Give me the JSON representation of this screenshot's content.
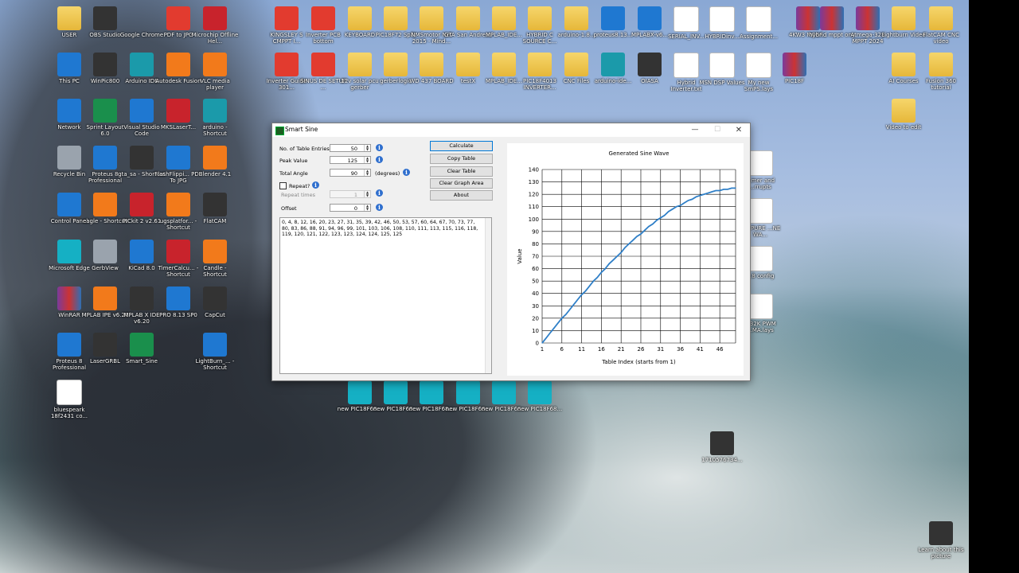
{
  "desktop": {
    "icons": [
      {
        "label": "USER",
        "color": "folder"
      },
      {
        "label": "OBS Studio",
        "color": "dark"
      },
      {
        "label": "Google Chrome",
        "color": "round"
      },
      {
        "label": "PDF to JPG",
        "color": "pdf"
      },
      {
        "label": "Microchip Offline Hel...",
        "color": "red"
      },
      {
        "label": "This PC",
        "color": "blue"
      },
      {
        "label": "WinPic800",
        "color": "dark"
      },
      {
        "label": "Arduino IDE",
        "color": "teal"
      },
      {
        "label": "Autodesk Fusion",
        "color": "orange"
      },
      {
        "label": "VLC media player",
        "color": "orange"
      },
      {
        "label": "Network",
        "color": "blue"
      },
      {
        "label": "Sprint Layout 6.0",
        "color": "green"
      },
      {
        "label": "Visual Studio Code",
        "color": "blue"
      },
      {
        "label": "MKSLaserT...",
        "color": "red"
      },
      {
        "label": "arduino - Shortcut",
        "color": "teal"
      },
      {
        "label": "Recycle Bin",
        "color": "gray"
      },
      {
        "label": "Proteus 8 Professional",
        "color": "blue"
      },
      {
        "label": "gta_sa - Shortcut",
        "color": "dark"
      },
      {
        "label": "FlashFlippi... PDF To JPG",
        "color": "blue"
      },
      {
        "label": "Blender 4.1",
        "color": "orange"
      },
      {
        "label": "Control Panel",
        "color": "blue"
      },
      {
        "label": "eagle - Shortcut",
        "color": "orange"
      },
      {
        "label": "PICkit 2 v2.61",
        "color": "red"
      },
      {
        "label": "ugsplatfor... - Shortcut",
        "color": "orange"
      },
      {
        "label": "FlatCAM",
        "color": "dark"
      },
      {
        "label": "Microsoft Edge",
        "color": "cyan"
      },
      {
        "label": "GerbView",
        "color": "gray"
      },
      {
        "label": "KiCad 8.0",
        "color": "blue"
      },
      {
        "label": "TimerCalcu... - Shortcut",
        "color": "red"
      },
      {
        "label": "Candle - Shortcut",
        "color": "orange"
      },
      {
        "label": "WinRAR",
        "color": "rar"
      },
      {
        "label": "MPLAB IPE v6.20",
        "color": "orange"
      },
      {
        "label": "MPLAB X IDE v6.20",
        "color": "dark"
      },
      {
        "label": "PRO 8.13 SP0",
        "color": "blue"
      },
      {
        "label": "CapCut",
        "color": "dark"
      },
      {
        "label": "Proteus 8 Professional",
        "color": "blue"
      },
      {
        "label": "LaserGRBL",
        "color": "dark"
      },
      {
        "label": "Smart_Sine",
        "color": "green"
      },
      {
        "label": "LightBurn_... - Shortcut",
        "color": "blue"
      },
      {
        "label": "bluespeark 18f2431 co...",
        "color": "doc"
      },
      {
        "label": "KINGSLEY S CMPPT I...",
        "color": "pdf"
      },
      {
        "label": "Inverter PCB bottom",
        "color": "pdf"
      },
      {
        "label": "KEYBOARD",
        "color": "folder"
      },
      {
        "label": "PIC18F72 Split",
        "color": "folder"
      },
      {
        "label": "NMSmotor Net 2015 - Mind...",
        "color": "folder"
      },
      {
        "label": "GTA San Andreas",
        "color": "folder"
      },
      {
        "label": "MPLAB_IDE...",
        "color": "folder"
      },
      {
        "label": "HYBRID C SOURCE C...",
        "color": "folder"
      },
      {
        "label": "arduino-1.8...",
        "color": "folder"
      },
      {
        "label": "proteus8.13...",
        "color": "blue"
      },
      {
        "label": "MPLABX-v6...",
        "color": "blue"
      },
      {
        "label": "SERIAL_INV...",
        "color": "doc"
      },
      {
        "label": "HYBRIDinv...",
        "color": "doc"
      },
      {
        "label": "Assignment...",
        "color": "doc"
      },
      {
        "label": "4KW3 MOSF...",
        "color": "rar"
      },
      {
        "label": "hybrid mppt ony",
        "color": "rar"
      },
      {
        "label": "Atmega-328 MPPT 2024",
        "color": "rar"
      },
      {
        "label": "Lightburn Video",
        "color": "folder"
      },
      {
        "label": "FlatCAM CNC video",
        "color": "folder"
      },
      {
        "label": "Inverter Guide 301...",
        "color": "pdf"
      },
      {
        "label": "SINUS DE SETUP ...",
        "color": "pdf"
      },
      {
        "label": "12v solar pcu gerber",
        "color": "folder"
      },
      {
        "label": "gerberlogic",
        "color": "folder"
      },
      {
        "label": "WD 437 BOARD",
        "color": "folder"
      },
      {
        "label": "testX",
        "color": "folder"
      },
      {
        "label": "MPLAB_IDE...",
        "color": "folder"
      },
      {
        "label": "PIC18F4013 INVERTER...",
        "color": "folder"
      },
      {
        "label": "CNC Files",
        "color": "folder"
      },
      {
        "label": "arduino-ide...",
        "color": "teal"
      },
      {
        "label": "OIASA",
        "color": "dark"
      },
      {
        "label": "Hybrid Inverter.txt",
        "color": "doc"
      },
      {
        "label": "MSN DSP Values",
        "color": "doc"
      },
      {
        "label": "My new SmPS.lays",
        "color": "doc"
      },
      {
        "label": "PIC18F",
        "color": "rar"
      },
      {
        "label": "AI Courses",
        "color": "folder"
      },
      {
        "label": "Fusion 360 tutorial",
        "color": "folder"
      },
      {
        "label": "Video to edit",
        "color": "folder"
      },
      {
        "label": "Learn about this picture",
        "color": "dark"
      }
    ],
    "file_icons_bottom": [
      "new PIC18F68...",
      "new PIC18F68...",
      "new PIC18F68...",
      "new PIC18F68...",
      "new PIC18F68...",
      "new PIC18F68..."
    ],
    "right_partial_labels": [
      "...mer and ...rrupts",
      "...8 PURE ...NE WA...",
      "...8 config",
      "...32K PWM ...MA.lays"
    ],
    "video_file": "1710576734..."
  },
  "window": {
    "title": "Smart Sine",
    "minimize": "—",
    "maximize": "☐",
    "close": "✕",
    "fields": {
      "entries_label": "No. of Table Entries",
      "entries_value": "50",
      "peak_label": "Peak Value",
      "peak_value": "125",
      "angle_label": "Total Angle",
      "angle_value": "90",
      "angle_unit": "(degrees)",
      "repeat_label": "Repeat?",
      "repeat_times_label": "Repeat times",
      "repeat_times_value": "1",
      "offset_label": "Offset",
      "offset_value": "0"
    },
    "buttons": {
      "calculate": "Calculate",
      "copy_table": "Copy Table",
      "clear_table": "Clear Table",
      "clear_graph": "Clear Graph Area",
      "about": "About"
    },
    "output_text": "0, 4, 8, 12, 16, 20, 23, 27, 31, 35, 39, 42, 46, 50, 53, 57, 60, 64, 67, 70, 73, 77, 80, 83, 86, 88, 91, 94, 96, 99, 101, 103, 106, 108, 110, 111, 113, 115, 116, 118, 119, 120, 121, 122, 123, 123, 124, 124, 125, 125"
  },
  "chart_data": {
    "type": "line",
    "title": "Generated Sine Wave",
    "xlabel": "Table Index (starts from 1)",
    "ylabel": "Value",
    "x_ticks": [
      1,
      6,
      11,
      16,
      21,
      26,
      31,
      36,
      41,
      46
    ],
    "y_ticks": [
      0,
      10,
      20,
      30,
      40,
      50,
      60,
      70,
      80,
      90,
      100,
      110,
      120,
      130,
      140
    ],
    "xlim": [
      1,
      50
    ],
    "ylim": [
      0,
      140
    ],
    "grid": true,
    "line_color": "#2f7fc7",
    "x": [
      1,
      2,
      3,
      4,
      5,
      6,
      7,
      8,
      9,
      10,
      11,
      12,
      13,
      14,
      15,
      16,
      17,
      18,
      19,
      20,
      21,
      22,
      23,
      24,
      25,
      26,
      27,
      28,
      29,
      30,
      31,
      32,
      33,
      34,
      35,
      36,
      37,
      38,
      39,
      40,
      41,
      42,
      43,
      44,
      45,
      46,
      47,
      48,
      49,
      50
    ],
    "values": [
      0,
      4,
      8,
      12,
      16,
      20,
      23,
      27,
      31,
      35,
      39,
      42,
      46,
      50,
      53,
      57,
      60,
      64,
      67,
      70,
      73,
      77,
      80,
      83,
      86,
      88,
      91,
      94,
      96,
      99,
      101,
      103,
      106,
      108,
      110,
      111,
      113,
      115,
      116,
      118,
      119,
      120,
      121,
      122,
      123,
      123,
      124,
      124,
      125,
      125
    ]
  }
}
